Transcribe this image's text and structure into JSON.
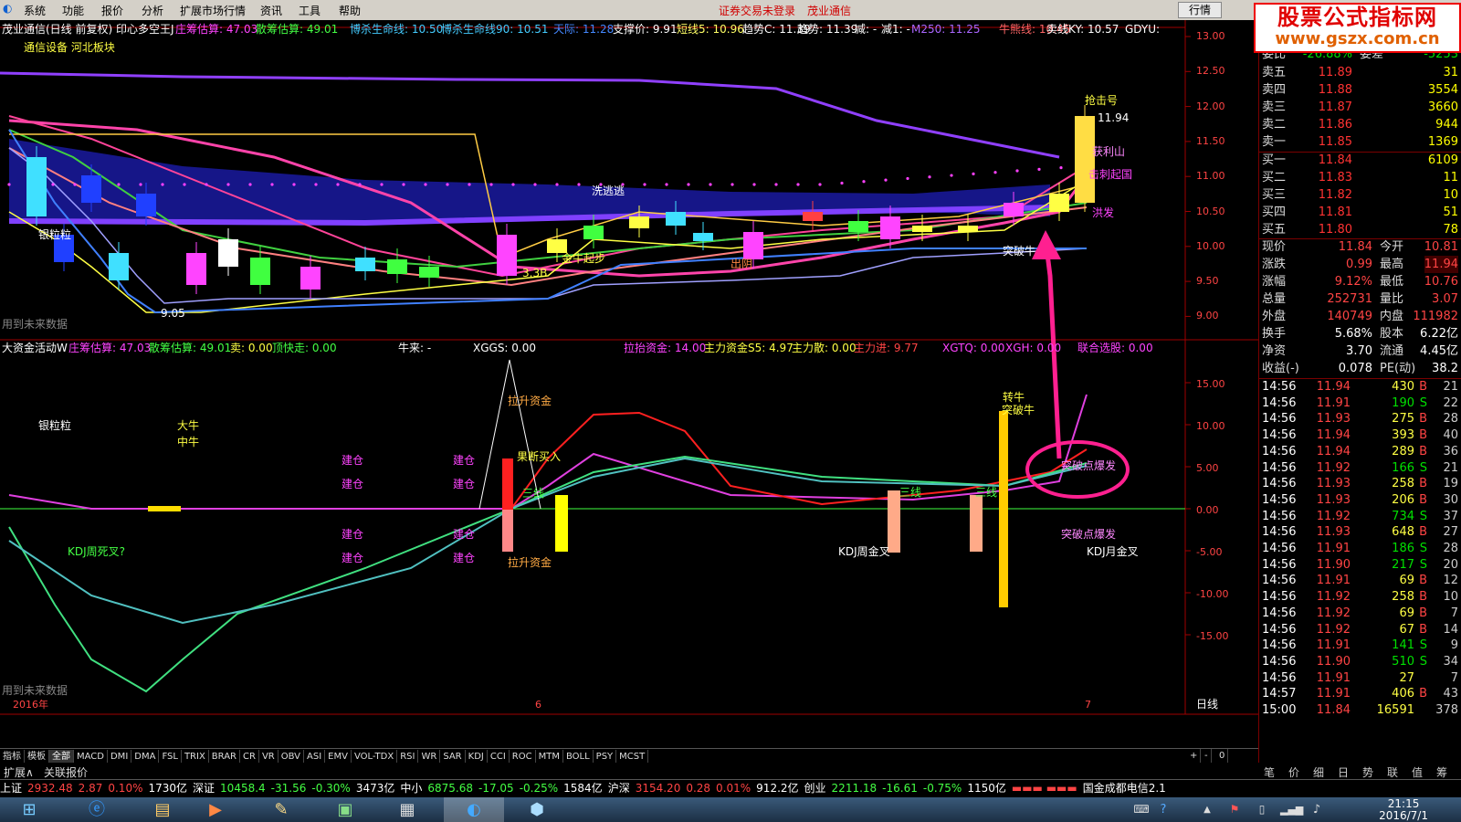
{
  "menu": {
    "items": [
      "系统",
      "功能",
      "报价",
      "分析",
      "扩展市场行情",
      "资讯",
      "工具",
      "帮助"
    ],
    "trade_warning": "证券交易未登录",
    "stock": "茂业通信",
    "trade_btn": "行情"
  },
  "brand": {
    "line1": "股票公式指标网",
    "line2": "www.gszx.com.cn"
  },
  "header1": [
    {
      "t": "茂业通信(日线 前复权) 印心多空王J",
      "c": "#ffffff"
    },
    {
      "t": "庄筹估算: 47.03",
      "c": "#ff44ff"
    },
    {
      "t": "散筹估算: 49.01",
      "c": "#44ff44"
    },
    {
      "t": "博杀生命线: 10.50",
      "c": "#44ccff"
    },
    {
      "t": "博杀生命线90: 10.51",
      "c": "#44ccff"
    },
    {
      "t": "天际: 11.28",
      "c": "#4488ff"
    },
    {
      "t": "支撑价: 9.91",
      "c": "#ffffff"
    },
    {
      "t": "短线5: 10.96",
      "c": "#ffff66"
    },
    {
      "t": "趋势C: 11.39",
      "c": "#ffffff"
    },
    {
      "t": "趋势: 11.39",
      "c": "#ffffff"
    },
    {
      "t": "减: -",
      "c": "#ffffff"
    },
    {
      "t": "减1: -",
      "c": "#ffffff"
    },
    {
      "t": "M250: 11.25",
      "c": "#aa66ff"
    },
    {
      "t": "牛熊线: 10.45",
      "c": "#ff6666"
    },
    {
      "t": "卖线KY: 10.57",
      "c": "#ffffff"
    },
    {
      "t": "GDYU:",
      "c": "#ffffff"
    }
  ],
  "sector_label": "通信设备 河北板块",
  "price_axis": [
    "13.00",
    "12.50",
    "12.00",
    "11.50",
    "11.00",
    "10.50",
    "10.00",
    "9.50",
    "9.00"
  ],
  "price_labels": [
    {
      "t": "银粒粒",
      "c": "#ffffff"
    },
    {
      "t": "抢击号",
      "c": "#ffff44"
    },
    {
      "t": "11.94",
      "c": "#ffffff"
    },
    {
      "t": "获利山",
      "c": "#ff88ff"
    },
    {
      "t": "击刺起国",
      "c": "#ff44ff"
    },
    {
      "t": "洪发",
      "c": "#ff44ff"
    },
    {
      "t": "洗逃逃",
      "c": "#ffffff"
    },
    {
      "t": "金牛起步",
      "c": "#ffff44"
    },
    {
      "t": "突破牛",
      "c": "#ffffff"
    },
    {
      "t": "9.05",
      "c": "#ffffff"
    },
    {
      "t": "3.3B",
      "c": "#ffff44"
    },
    {
      "t": "出阴",
      "c": "#ff8844"
    },
    {
      "t": "用到未来数据",
      "c": "#888888"
    }
  ],
  "header2": [
    {
      "t": "大资金活动W",
      "c": "#ffffff"
    },
    {
      "t": "庄筹估算: 47.03",
      "c": "#ff44ff"
    },
    {
      "t": "散筹估算: 49.01",
      "c": "#44ff44"
    },
    {
      "t": "卖: 0.00",
      "c": "#ffff44"
    },
    {
      "t": "顶快走: 0.00",
      "c": "#44ff44"
    },
    {
      "t": "牛来: -",
      "c": "#ffffff"
    },
    {
      "t": "XGGS: 0.00",
      "c": "#ffffff"
    },
    {
      "t": "拉抬资金: 14.00",
      "c": "#ff44ff"
    },
    {
      "t": "主力资金S5: 4.97",
      "c": "#ffff44"
    },
    {
      "t": "主力散: 0.00",
      "c": "#ffff44"
    },
    {
      "t": "主力进: 9.77",
      "c": "#ff4444"
    },
    {
      "t": "XGTQ: 0.00",
      "c": "#ff44ff"
    },
    {
      "t": "XGH: 0.00",
      "c": "#ff44ff"
    },
    {
      "t": "联合选股: 0.00",
      "c": "#ff44ff"
    }
  ],
  "ind_axis": [
    "15.00",
    "10.00",
    "5.00",
    "0.00",
    "-5.00",
    "-10.00",
    "-15.00"
  ],
  "ind_labels": [
    {
      "t": "银粒粒",
      "c": "#ffffff"
    },
    {
      "t": "大牛",
      "c": "#ffff44"
    },
    {
      "t": "中牛",
      "c": "#ffff44"
    },
    {
      "t": "建仓",
      "c": "#ff44ff"
    },
    {
      "t": "建仓",
      "c": "#ff44ff"
    },
    {
      "t": "建仓",
      "c": "#ff44ff"
    },
    {
      "t": "建仓",
      "c": "#ff44ff"
    },
    {
      "t": "建仓",
      "c": "#ff44ff"
    },
    {
      "t": "建仓",
      "c": "#ff44ff"
    },
    {
      "t": "建仓",
      "c": "#ff44ff"
    },
    {
      "t": "建仓",
      "c": "#ff44ff"
    },
    {
      "t": "拉升资金",
      "c": "#ffaa44"
    },
    {
      "t": "拉升资金",
      "c": "#ffaa44"
    },
    {
      "t": "果断买入",
      "c": "#ffff44"
    },
    {
      "t": "三线",
      "c": "#44ff44"
    },
    {
      "t": "KDJ周死叉?",
      "c": "#44ff44"
    },
    {
      "t": "KDJ周金叉",
      "c": "#ffffff"
    },
    {
      "t": "转牛",
      "c": "#ffff44"
    },
    {
      "t": "突破牛",
      "c": "#ffff44"
    },
    {
      "t": "突破点爆发",
      "c": "#ff88ff"
    },
    {
      "t": "突破点爆发",
      "c": "#ff88ff"
    },
    {
      "t": "KDJ月金叉",
      "c": "#ffffff"
    },
    {
      "t": "三线",
      "c": "#44ff44"
    },
    {
      "t": "三线",
      "c": "#44ff44"
    },
    {
      "t": "用到未来数据",
      "c": "#888888"
    }
  ],
  "time_axis": {
    "year": "2016年",
    "m6": "6",
    "m7": "7",
    "period": "日线"
  },
  "tabs": [
    "指标",
    "模板",
    "全部",
    "MACD",
    "DMI",
    "DMA",
    "FSL",
    "TRIX",
    "BRAR",
    "CR",
    "VR",
    "OBV",
    "ASI",
    "EMV",
    "VOL-TDX",
    "RSI",
    "WR",
    "SAR",
    "KDJ",
    "CCI",
    "ROC",
    "MTM",
    "BOLL",
    "PSY",
    "MCST"
  ],
  "tabs_right": [
    "+",
    "-",
    "0"
  ],
  "tabs2": [
    "扩展∧",
    "关联报价"
  ],
  "order_book": {
    "top_row": {
      "label": "委比",
      "price": "-26.88%",
      "label2": "委差",
      "vol": "-5253"
    },
    "asks": [
      {
        "label": "卖五",
        "price": "11.89",
        "vol": "31"
      },
      {
        "label": "卖四",
        "price": "11.88",
        "vol": "3554"
      },
      {
        "label": "卖三",
        "price": "11.87",
        "vol": "3660"
      },
      {
        "label": "卖二",
        "price": "11.86",
        "vol": "944"
      },
      {
        "label": "卖一",
        "price": "11.85",
        "vol": "1369"
      }
    ],
    "bids": [
      {
        "label": "买一",
        "price": "11.84",
        "vol": "6109"
      },
      {
        "label": "买二",
        "price": "11.83",
        "vol": "11"
      },
      {
        "label": "买三",
        "price": "11.82",
        "vol": "10"
      },
      {
        "label": "买四",
        "price": "11.81",
        "vol": "51"
      },
      {
        "label": "买五",
        "price": "11.80",
        "vol": "78"
      }
    ]
  },
  "quote": [
    {
      "l1": "现价",
      "v1": "11.84",
      "l2": "今开",
      "v2": "10.81"
    },
    {
      "l1": "涨跌",
      "v1": "0.99",
      "l2": "最高",
      "v2": "11.94"
    },
    {
      "l1": "涨幅",
      "v1": "9.12%",
      "l2": "最低",
      "v2": "10.76"
    },
    {
      "l1": "总量",
      "v1": "252731",
      "l2": "量比",
      "v2": "3.07"
    },
    {
      "l1": "外盘",
      "v1": "140749",
      "l2": "内盘",
      "v2": "111982"
    },
    {
      "l1": "换手",
      "v1": "5.68%",
      "l2": "股本",
      "v2": "6.22亿"
    },
    {
      "l1": "净资",
      "v1": "3.70",
      "l2": "流通",
      "v2": "4.45亿"
    },
    {
      "l1": "收益(-)",
      "v1": "0.078",
      "l2": "PE(动)",
      "v2": "38.2"
    }
  ],
  "trades": [
    {
      "time": "14:56",
      "price": "11.94",
      "vol": "430",
      "bs": "B",
      "n": "21"
    },
    {
      "time": "14:56",
      "price": "11.91",
      "vol": "190",
      "bs": "S",
      "n": "22"
    },
    {
      "time": "14:56",
      "price": "11.93",
      "vol": "275",
      "bs": "B",
      "n": "28"
    },
    {
      "time": "14:56",
      "price": "11.94",
      "vol": "393",
      "bs": "B",
      "n": "40"
    },
    {
      "time": "14:56",
      "price": "11.94",
      "vol": "289",
      "bs": "B",
      "n": "36"
    },
    {
      "time": "14:56",
      "price": "11.92",
      "vol": "166",
      "bs": "S",
      "n": "21"
    },
    {
      "time": "14:56",
      "price": "11.93",
      "vol": "258",
      "bs": "B",
      "n": "19"
    },
    {
      "time": "14:56",
      "price": "11.93",
      "vol": "206",
      "bs": "B",
      "n": "30"
    },
    {
      "time": "14:56",
      "price": "11.92",
      "vol": "734",
      "bs": "S",
      "n": "37"
    },
    {
      "time": "14:56",
      "price": "11.93",
      "vol": "648",
      "bs": "B",
      "n": "27"
    },
    {
      "time": "14:56",
      "price": "11.91",
      "vol": "186",
      "bs": "S",
      "n": "28"
    },
    {
      "time": "14:56",
      "price": "11.90",
      "vol": "217",
      "bs": "S",
      "n": "20"
    },
    {
      "time": "14:56",
      "price": "11.91",
      "vol": "69",
      "bs": "B",
      "n": "12"
    },
    {
      "time": "14:56",
      "price": "11.92",
      "vol": "258",
      "bs": "B",
      "n": "10"
    },
    {
      "time": "14:56",
      "price": "11.92",
      "vol": "69",
      "bs": "B",
      "n": "7"
    },
    {
      "time": "14:56",
      "price": "11.92",
      "vol": "67",
      "bs": "B",
      "n": "14"
    },
    {
      "time": "14:56",
      "price": "11.91",
      "vol": "141",
      "bs": "S",
      "n": "9"
    },
    {
      "time": "14:56",
      "price": "11.90",
      "vol": "510",
      "bs": "S",
      "n": "34"
    },
    {
      "time": "14:56",
      "price": "11.91",
      "vol": "27",
      "bs": "",
      "n": "7"
    },
    {
      "time": "14:57",
      "price": "11.91",
      "vol": "406",
      "bs": "B",
      "n": "43"
    },
    {
      "time": "15:00",
      "price": "11.84",
      "vol": "16591",
      "bs": "",
      "n": "378"
    }
  ],
  "panel_tabs": [
    "笔",
    "价",
    "细",
    "日",
    "势",
    "联",
    "值",
    "筹"
  ],
  "status": [
    {
      "t": "上证",
      "c": "#ffffff"
    },
    {
      "t": "2932.48",
      "c": "#ff4444"
    },
    {
      "t": "2.87",
      "c": "#ff4444"
    },
    {
      "t": "0.10%",
      "c": "#ff4444"
    },
    {
      "t": "1730亿",
      "c": "#ffffff"
    },
    {
      "t": "深证",
      "c": "#ffffff"
    },
    {
      "t": "10458.4",
      "c": "#44ff44"
    },
    {
      "t": "-31.56",
      "c": "#44ff44"
    },
    {
      "t": "-0.30%",
      "c": "#44ff44"
    },
    {
      "t": "3473亿",
      "c": "#ffffff"
    },
    {
      "t": "中小",
      "c": "#ffffff"
    },
    {
      "t": "6875.68",
      "c": "#44ff44"
    },
    {
      "t": "-17.05",
      "c": "#44ff44"
    },
    {
      "t": "-0.25%",
      "c": "#44ff44"
    },
    {
      "t": "1584亿",
      "c": "#ffffff"
    },
    {
      "t": "沪深",
      "c": "#ffffff"
    },
    {
      "t": "3154.20",
      "c": "#ff4444"
    },
    {
      "t": "0.28",
      "c": "#ff4444"
    },
    {
      "t": "0.01%",
      "c": "#ff4444"
    },
    {
      "t": "912.2亿",
      "c": "#ffffff"
    },
    {
      "t": "创业",
      "c": "#ffffff"
    },
    {
      "t": "2211.18",
      "c": "#44ff44"
    },
    {
      "t": "-16.61",
      "c": "#44ff44"
    },
    {
      "t": "-0.75%",
      "c": "#44ff44"
    },
    {
      "t": "1150亿",
      "c": "#ffffff"
    }
  ],
  "status_server": "国金成都电信2.1",
  "clock": {
    "time": "21:15",
    "date": "2016/7/1"
  }
}
